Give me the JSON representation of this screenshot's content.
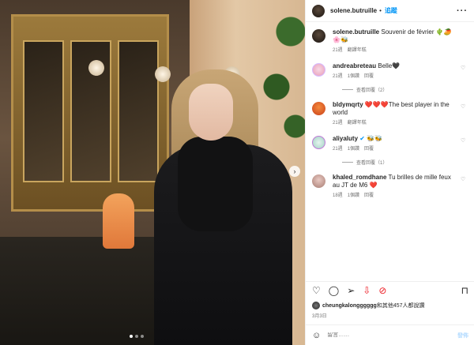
{
  "post": {
    "username": "solene.butruille",
    "follow_label": "追蹤",
    "separator": "•",
    "more_icon": "more-horizontal-icon"
  },
  "caption": {
    "username": "solene.butruille",
    "text": "Souvenir de février 🌵🥭🌸🐝",
    "time": "21週",
    "translate": "翻譯年糕"
  },
  "comments": [
    {
      "username": "andreabreteau",
      "text": "Belle🖤",
      "time": "21週",
      "likes": "1個讚",
      "reply": "回覆",
      "avatar_color": "#f3c3d6"
    },
    {
      "username": "bldymqrty",
      "text": "❤️❤️❤️The best player in the world",
      "time": "21週",
      "translate": "翻譯年糕",
      "avatar_color": "#e25c1e"
    },
    {
      "username": "aliyaluty",
      "text": "🐝🐝",
      "time": "21週",
      "likes": "1個讚",
      "reply": "回覆",
      "verified": true,
      "avatar_color": "#cfe8e0"
    },
    {
      "username": "khaled_romdhane",
      "text": "Tu brilles de mille feux au JT de M6 ❤️",
      "time": "18週",
      "likes": "1個讚",
      "reply": "回覆",
      "avatar_color": "#c9a7a0"
    }
  ],
  "view_replies": [
    {
      "label": "查看回覆（2）"
    },
    {
      "label": "查看回覆（1）"
    }
  ],
  "actions": {
    "like_icon": "heart-icon",
    "comment_icon": "comment-icon",
    "share_icon": "paper-plane-icon",
    "download_icon": "download-icon",
    "extension_icon": "red-circle-icon",
    "save_icon": "bookmark-icon"
  },
  "likes_line": {
    "user": "cheungkalongggggg",
    "text": "和其他457人都說讚"
  },
  "post_date": "3月3日",
  "add_comment": {
    "placeholder": "留言……",
    "post_label": "發佈"
  }
}
